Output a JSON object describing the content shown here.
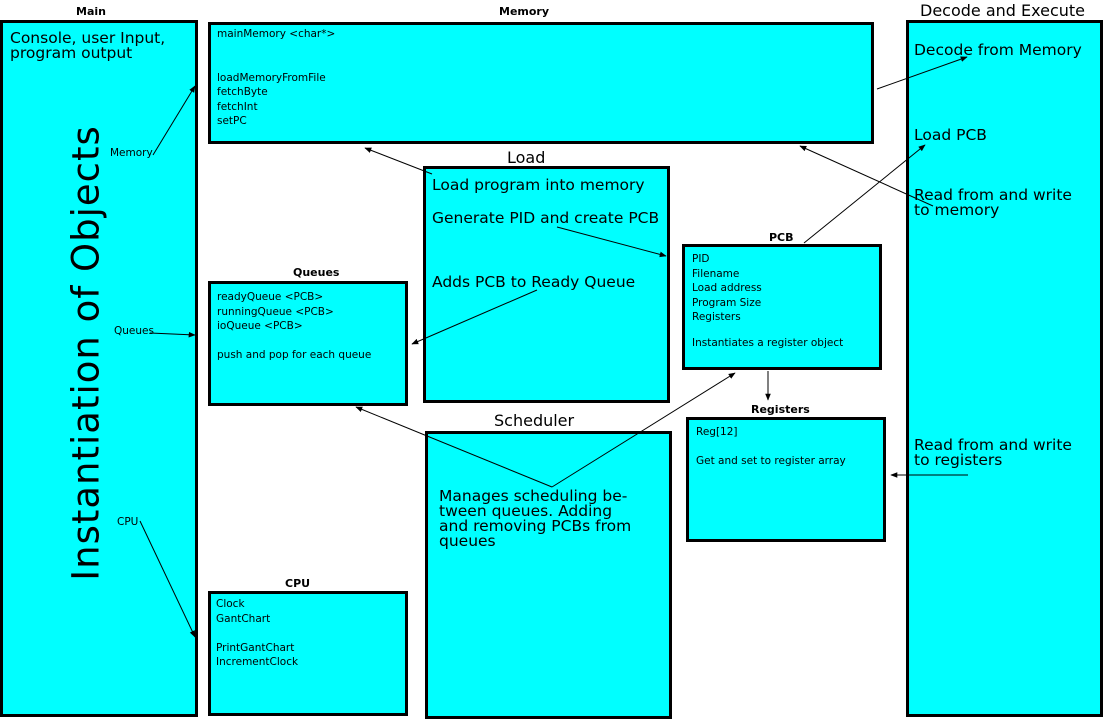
{
  "main": {
    "title": "Main",
    "console_text": [
      "Console, user Input,",
      "program output"
    ],
    "vertical_text": "Instantiation of Objects",
    "arrow_labels": {
      "memory": "Memory",
      "queues": "Queues",
      "cpu": "CPU"
    }
  },
  "memory": {
    "title": "Memory",
    "lines": [
      "mainMemory <char*>",
      "",
      "",
      "loadMemoryFromFile",
      "fetchByte",
      "fetchInt",
      "setPC"
    ]
  },
  "load": {
    "title": "Load",
    "items": [
      "Load program into memory",
      "Generate PID and create PCB",
      "Adds PCB to Ready Queue"
    ]
  },
  "queues": {
    "title": "Queues",
    "lines": [
      "readyQueue <PCB>",
      "runningQueue <PCB>",
      "ioQueue <PCB>",
      "",
      "push and pop for each queue"
    ]
  },
  "pcb": {
    "title": "PCB",
    "lines": [
      "PID",
      "Filename",
      "Load address",
      "Program Size",
      "Registers",
      "",
      "Instantiates a register object"
    ]
  },
  "registers": {
    "title": "Registers",
    "lines": [
      "Reg[12]",
      "",
      "Get and set to register array"
    ]
  },
  "scheduler": {
    "title": "Scheduler",
    "lines": [
      "Manages scheduling be-",
      "tween queues.  Adding",
      "and removing PCBs from",
      "queues"
    ]
  },
  "cpu": {
    "title": "CPU",
    "lines": [
      "Clock",
      "GantChart",
      "",
      "PrintGantChart",
      "IncrementClock"
    ]
  },
  "decode": {
    "title": "Decode and Execute",
    "item1": "Decode from Memory",
    "item2": "Load PCB",
    "item3": [
      "Read from and write",
      "to memory"
    ],
    "item4": [
      "Read from and write",
      "to registers"
    ]
  },
  "colors": {
    "box_fill": "#00ffff",
    "border": "#000000",
    "background": "#ffffff"
  }
}
